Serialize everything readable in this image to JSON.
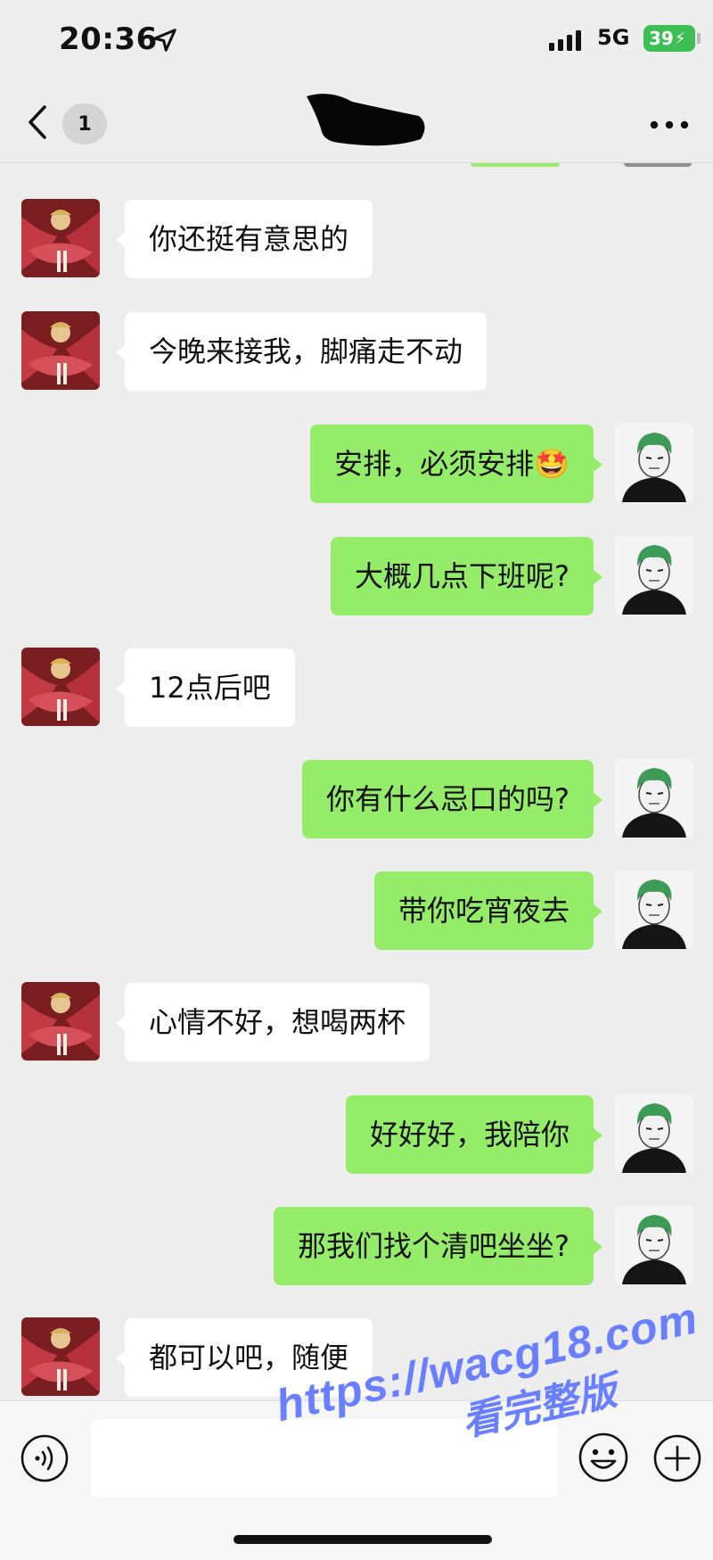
{
  "status_bar": {
    "time": "20:36",
    "network": "5G",
    "battery": "39"
  },
  "header": {
    "unread_count": "1",
    "title": ""
  },
  "messages": [
    {
      "side": "left",
      "text": "你还挺有意思的"
    },
    {
      "side": "left",
      "text": "今晚来接我，脚痛走不动"
    },
    {
      "side": "right",
      "text": "安排，必须安排🤩"
    },
    {
      "side": "right",
      "text": "大概几点下班呢?"
    },
    {
      "side": "left",
      "text": "12点后吧"
    },
    {
      "side": "right",
      "text": "你有什么忌口的吗?"
    },
    {
      "side": "right",
      "text": "带你吃宵夜去"
    },
    {
      "side": "left",
      "text": "心情不好，想喝两杯"
    },
    {
      "side": "right",
      "text": "好好好，我陪你"
    },
    {
      "side": "right",
      "text": "那我们找个清吧坐坐?"
    },
    {
      "side": "left",
      "text": "都可以吧，随便"
    }
  ],
  "input_bar": {
    "placeholder": ""
  },
  "watermark": {
    "url": "https://wacg18.com",
    "subtitle": "看完整版"
  },
  "colors": {
    "sent_bubble": "#95ec69",
    "received_bubble": "#ffffff",
    "background": "#ededed",
    "battery": "#3dbf55",
    "watermark": "#6a7fff"
  },
  "icons": [
    "location-arrow-icon",
    "signal-icon",
    "back-icon",
    "more-icon",
    "voice-icon",
    "emoji-icon",
    "plus-icon"
  ]
}
